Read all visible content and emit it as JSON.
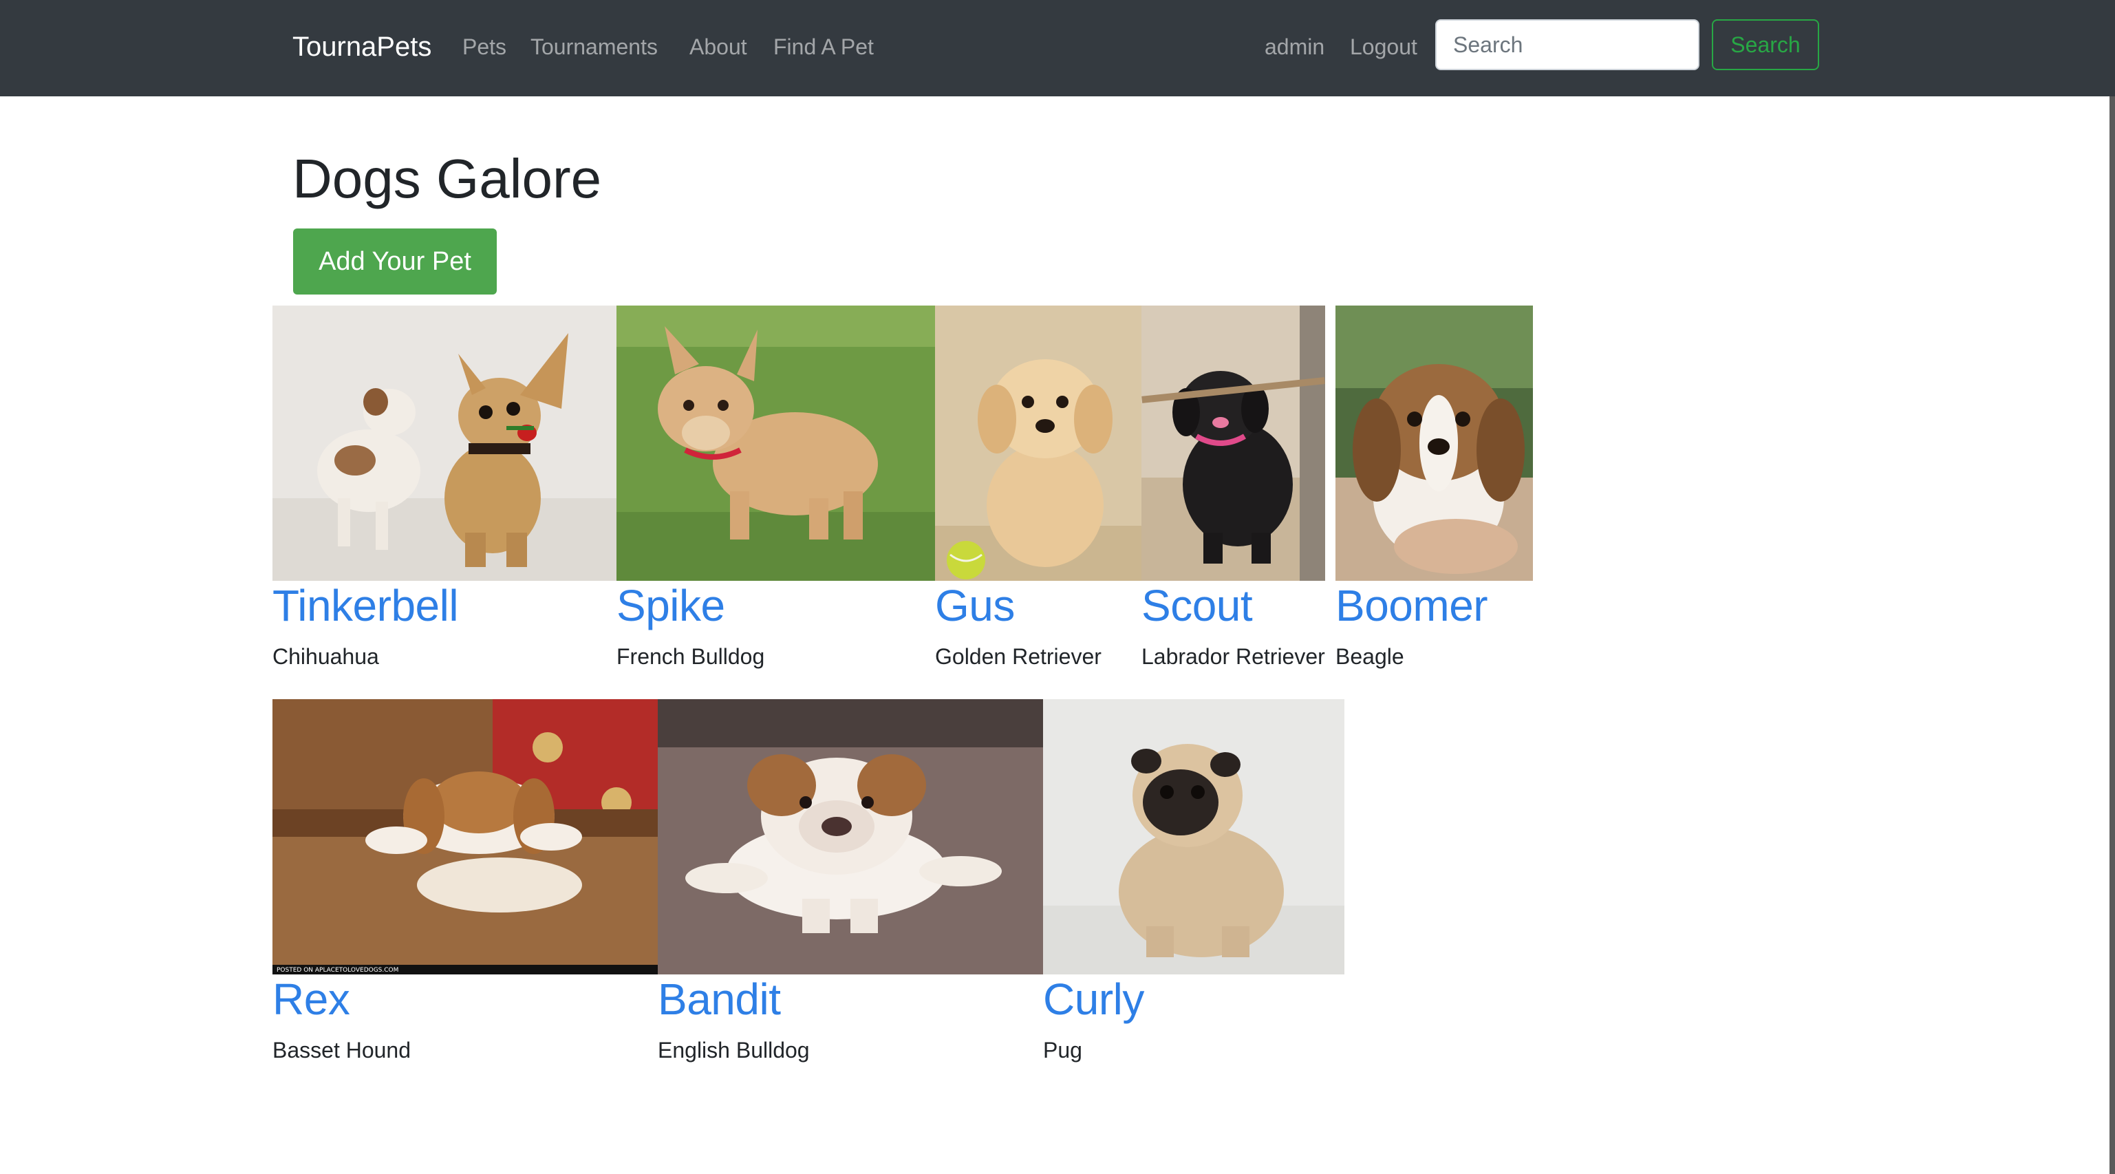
{
  "navbar": {
    "brand": "TournaPets",
    "links": [
      "Pets",
      "Tournaments",
      "About",
      "Find A Pet"
    ],
    "user": "admin",
    "logout": "Logout",
    "search_placeholder": "Search",
    "search_button": "Search",
    "background": "#343a40"
  },
  "page": {
    "title": "Dogs Galore",
    "add_button": "Add Your Pet"
  },
  "pets": [
    {
      "name": "Tinkerbell",
      "breed": "Chihuahua",
      "image": "chihuahua puppy with plush toy dog"
    },
    {
      "name": "Spike",
      "breed": "French Bulldog",
      "image": "french bulldog puppy on grass"
    },
    {
      "name": "Gus",
      "breed": "Golden Retriever",
      "image": "golden retriever puppy with tennis ball"
    },
    {
      "name": "Scout",
      "breed": "Labrador Retriever",
      "image": "black labrador puppy holding stick"
    },
    {
      "name": "Boomer",
      "breed": "Beagle",
      "image": "beagle puppy held in hand"
    },
    {
      "name": "Rex",
      "breed": "Basset Hound",
      "image": "basset hound puppy on couch",
      "caption": "POSTED ON APLACETOLOVEDOGS.COM"
    },
    {
      "name": "Bandit",
      "breed": "English Bulldog",
      "image": "english bulldog puppy on bricks"
    },
    {
      "name": "Curly",
      "breed": "Pug",
      "image": "pug puppy sitting"
    }
  ],
  "colors": {
    "link": "#2e7fe6",
    "success": "#4ea64e",
    "search_outline": "#28a745"
  }
}
